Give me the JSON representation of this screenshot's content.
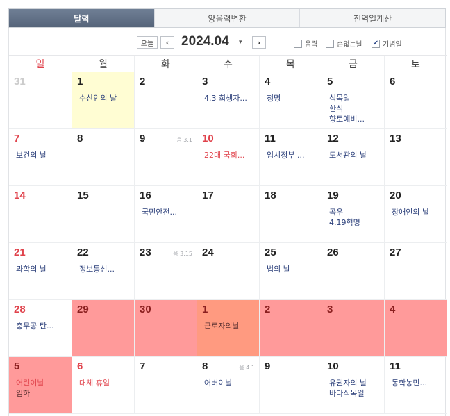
{
  "tabs": [
    {
      "label": "달력",
      "active": true
    },
    {
      "label": "양음력변환",
      "active": false
    },
    {
      "label": "전역일계산",
      "active": false
    }
  ],
  "toolbar": {
    "today_label": "오늘",
    "prev_icon": "‹",
    "next_icon": "›",
    "month_title": "2024.04",
    "caret_icon": "▾",
    "options": [
      {
        "label": "음력",
        "checked": false
      },
      {
        "label": "손없는날",
        "checked": false
      },
      {
        "label": "기념일",
        "checked": true
      }
    ]
  },
  "weekdays": [
    "일",
    "월",
    "화",
    "수",
    "목",
    "금",
    "토"
  ],
  "weeks": [
    [
      {
        "day": "31",
        "other": true,
        "events": []
      },
      {
        "day": "1",
        "today": true,
        "events": [
          "수산인의 날"
        ]
      },
      {
        "day": "2",
        "events": []
      },
      {
        "day": "3",
        "events": [
          "4.3 희생자..."
        ]
      },
      {
        "day": "4",
        "events": [
          "청명"
        ]
      },
      {
        "day": "5",
        "events": [
          "식목일",
          "한식",
          "향토예비..."
        ]
      },
      {
        "day": "6",
        "events": []
      }
    ],
    [
      {
        "day": "7",
        "events": [
          "보건의 날"
        ]
      },
      {
        "day": "8",
        "events": []
      },
      {
        "day": "9",
        "lunar": "음 3.1",
        "events": []
      },
      {
        "day": "10",
        "holiday": true,
        "events": [
          {
            "text": "22대 국회...",
            "red": true
          }
        ]
      },
      {
        "day": "11",
        "events": [
          "임시정부 ..."
        ]
      },
      {
        "day": "12",
        "events": [
          "도서관의 날"
        ]
      },
      {
        "day": "13",
        "events": []
      }
    ],
    [
      {
        "day": "14",
        "events": []
      },
      {
        "day": "15",
        "events": []
      },
      {
        "day": "16",
        "events": [
          "국민안전..."
        ]
      },
      {
        "day": "17",
        "events": []
      },
      {
        "day": "18",
        "events": []
      },
      {
        "day": "19",
        "events": [
          "곡우",
          "4.19혁명"
        ]
      },
      {
        "day": "20",
        "events": [
          "장애인의 날"
        ]
      }
    ],
    [
      {
        "day": "21",
        "events": [
          "과학의 날"
        ]
      },
      {
        "day": "22",
        "events": [
          "정보통신..."
        ]
      },
      {
        "day": "23",
        "lunar": "음 3.15",
        "events": []
      },
      {
        "day": "24",
        "events": []
      },
      {
        "day": "25",
        "events": [
          "법의 날"
        ]
      },
      {
        "day": "26",
        "events": []
      },
      {
        "day": "27",
        "events": []
      }
    ],
    [
      {
        "day": "28",
        "events": [
          "충무공 탄..."
        ]
      },
      {
        "day": "29",
        "mark": true,
        "events": []
      },
      {
        "day": "30",
        "mark": true,
        "events": []
      },
      {
        "day": "1",
        "mark_deep": true,
        "events": [
          {
            "text": "근로자의날",
            "dark": true
          }
        ]
      },
      {
        "day": "2",
        "mark": true,
        "events": []
      },
      {
        "day": "3",
        "mark": true,
        "events": []
      },
      {
        "day": "4",
        "mark": true,
        "events": []
      }
    ],
    [
      {
        "day": "5",
        "mark": true,
        "events": [
          {
            "text": "어린이날",
            "red": true
          },
          {
            "text": "입하",
            "dark": true
          }
        ]
      },
      {
        "day": "6",
        "holiday": true,
        "events": [
          {
            "text": "대체 휴일",
            "red": true
          }
        ]
      },
      {
        "day": "7",
        "events": []
      },
      {
        "day": "8",
        "lunar": "음 4.1",
        "events": [
          "어버이날"
        ]
      },
      {
        "day": "9",
        "events": []
      },
      {
        "day": "10",
        "events": [
          "유권자의 날",
          "바다식목일"
        ]
      },
      {
        "day": "11",
        "events": [
          "동학농민..."
        ]
      }
    ]
  ],
  "colors": {
    "tab_active": "#56657a",
    "sunday_red": "#e0434c",
    "event_blue": "#2b3f7a",
    "today_bg": "#fffdd3",
    "mark_bg": "#ff9a9a"
  }
}
